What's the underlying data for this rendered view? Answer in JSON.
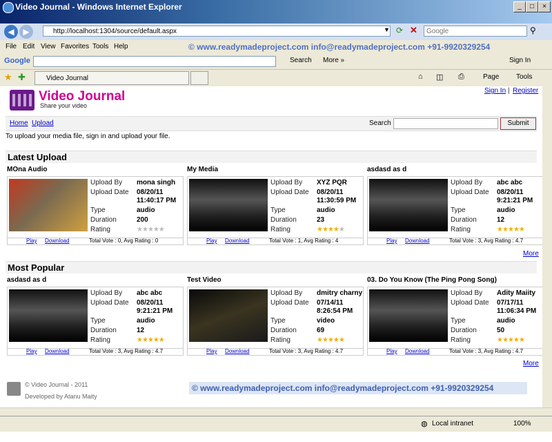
{
  "window": {
    "title": "Video Journal - Windows Internet Explorer"
  },
  "browser": {
    "url": "http://localhost:1304/source/default.aspx",
    "search_placeholder": "Google",
    "menu": [
      "File",
      "Edit",
      "View",
      "Favorites",
      "Tools",
      "Help"
    ],
    "watermark": "©  www.readymadeproject.com  info@readymadeproject.com  +91-9920329254",
    "google_label": "Google",
    "google_search": "Search",
    "google_more": "More »",
    "signin": "Sign In",
    "tab_title": "Video Journal",
    "page_menu": "Page",
    "tools_menu": "Tools",
    "status_zone": "Local intranet",
    "zoom": "100%"
  },
  "site": {
    "title": "Video Journal",
    "tagline": "Share your video",
    "signin": "Sign In",
    "separator": "|",
    "register": "Register",
    "nav": [
      "Home",
      "Upload"
    ],
    "search_label": "Search",
    "submit": "Submit",
    "info": "To upload your media file, sign in and upload your file."
  },
  "labels": {
    "upload_by": "Upload By",
    "upload_date": "Upload Date",
    "type": "Type",
    "duration": "Duration",
    "rating": "Rating",
    "play": "Play",
    "download": "Download",
    "more": "More"
  },
  "latest": {
    "heading": "Latest Upload",
    "items": [
      {
        "title": "MOna Audio",
        "by": "mona singh",
        "date": "08/20/11 11:40:17 PM",
        "type": "audio",
        "duration": "200",
        "stars": 0,
        "stats": "Total Vote : 0, Avg Rating : 0"
      },
      {
        "title": "My Media",
        "by": "XYZ PQR",
        "date": "08/20/11 11:30:59 PM",
        "type": "audio",
        "duration": "23",
        "stars": 4,
        "stats": "Total Vote : 1, Avg Rating : 4"
      },
      {
        "title": "asdasd as d",
        "by": "abc abc",
        "date": "08/20/11 9:21:21 PM",
        "type": "audio",
        "duration": "12",
        "stars": 5,
        "stats": "Total Vote : 3, Avg Rating : 4.7"
      }
    ]
  },
  "popular": {
    "heading": "Most Popular",
    "items": [
      {
        "title": "asdasd as d",
        "by": "abc abc",
        "date": "08/20/11 9:21:21 PM",
        "type": "audio",
        "duration": "12",
        "stars": 5,
        "stats": "Total Vote : 3, Avg Rating : 4.7"
      },
      {
        "title": "Test Video",
        "by": "dmitry charny",
        "date": "07/14/11 8:26:54 PM",
        "type": "video",
        "duration": "69",
        "stars": 5,
        "stats": "Total Vote : 3, Avg Rating : 4.7"
      },
      {
        "title": "03. Do You Know (The Ping Pong Song)",
        "by": "Adity Maiity",
        "date": "07/17/11 11:06:34 PM",
        "type": "audio",
        "duration": "50",
        "stars": 5,
        "stats": "Total Vote : 3, Avg Rating : 4.7"
      }
    ]
  },
  "footer": {
    "copyright": "© Video Journal - 2011",
    "developer": "Developed by Atanu Maity",
    "watermark": "©  www.readymadeproject.com  info@readymadeproject.com  +91-9920329254"
  }
}
